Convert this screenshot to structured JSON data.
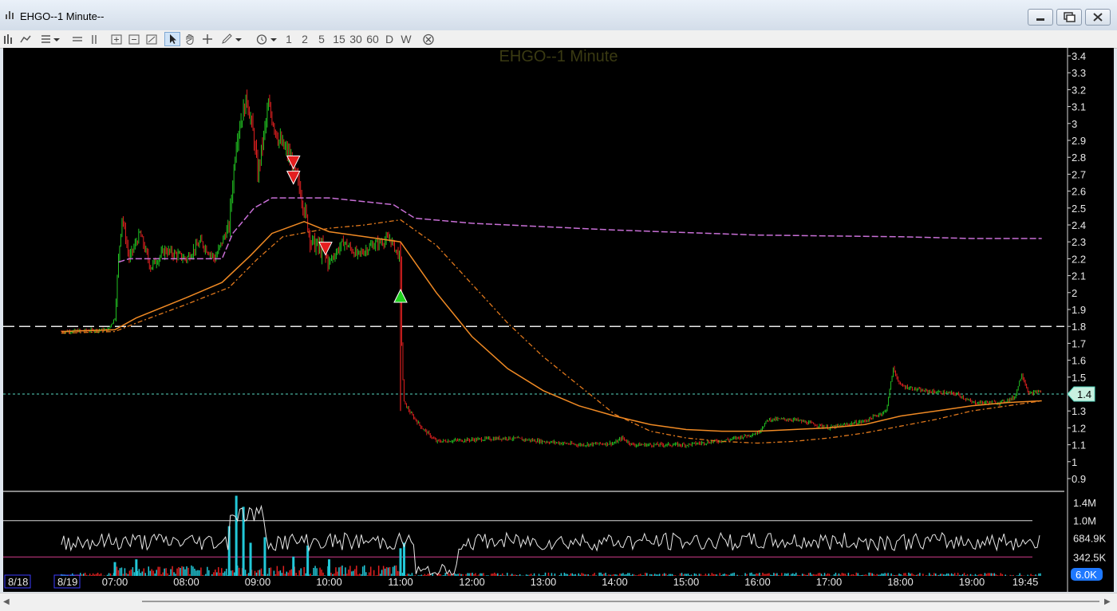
{
  "window": {
    "title": "EHGO--1 Minute--",
    "controls": [
      "minimize-icon",
      "maximize-icon",
      "close-icon"
    ]
  },
  "toolbar": {
    "tools": [
      "bar-chart-icon",
      "line-style-icon",
      "template-icon",
      "split-horizontal-icon",
      "split-vertical-icon",
      "zoom-in-icon",
      "zoom-out-icon",
      "zoom-fit-icon",
      "pointer-icon",
      "hand-icon",
      "crosshair-icon",
      "pencil-icon",
      "clock-icon"
    ],
    "intervals": [
      "1",
      "2",
      "5",
      "15",
      "30",
      "60",
      "D",
      "W"
    ],
    "close_all_icon": "circle-x-icon"
  },
  "chart": {
    "title": "EHGO--1 Minute",
    "price_axis_labels": [
      "3.4",
      "3.3",
      "3.2",
      "3.1",
      "3",
      "2.9",
      "2.8",
      "2.7",
      "2.6",
      "2.5",
      "2.4",
      "2.3",
      "2.2",
      "2.1",
      "2",
      "1.9",
      "1.8",
      "1.7",
      "1.6",
      "1.5",
      "1.4",
      "1.3",
      "1.2",
      "1.1",
      "1",
      "0.9"
    ],
    "last_price_badge": "1.4",
    "volume_axis_labels": [
      "1.4M",
      "1.0M",
      "684.9K",
      "342.5K"
    ],
    "volume_badge": "6.0K",
    "date_labels": [
      "8/18",
      "8/19"
    ],
    "time_labels": [
      "07:00",
      "08:00",
      "09:00",
      "10:00",
      "11:00",
      "12:00",
      "13:00",
      "14:00",
      "15:00",
      "16:00",
      "17:00",
      "18:00",
      "19:00",
      "19:45"
    ],
    "colors": {
      "background": "#000000",
      "up_candle": "#22c322",
      "down_candle": "#e02020",
      "vwap": "#c86fd6",
      "ema_fast": "#f08a24",
      "ema_slow_dashed": "#e0781c",
      "reference_line": "#e8e8e8",
      "last_price_line": "#58d8c0",
      "volume_bar_up": "#22c8d8",
      "volume_bar_down": "#e02020",
      "volume_line": "#e8e8e8",
      "volume_band_low": "#d23c8c",
      "sell_marker": "#e41e1e",
      "buy_marker": "#1ed21e",
      "title_text": "#3a3a12",
      "axis_text": "#e8e8e8",
      "volume_badge": "#1e78ff",
      "date_box": "#3c3cff"
    }
  },
  "chart_data": {
    "type": "candlestick",
    "title": "EHGO--1 Minute",
    "ylim": [
      0.9,
      3.45
    ],
    "reference_level": 1.8,
    "last_price": 1.4,
    "price_path": [
      [
        6.25,
        1.77
      ],
      [
        6.9,
        1.78
      ],
      [
        7.0,
        1.85
      ],
      [
        7.05,
        2.2
      ],
      [
        7.1,
        2.45
      ],
      [
        7.2,
        2.2
      ],
      [
        7.35,
        2.35
      ],
      [
        7.5,
        2.15
      ],
      [
        7.7,
        2.25
      ],
      [
        8.0,
        2.2
      ],
      [
        8.2,
        2.3
      ],
      [
        8.4,
        2.2
      ],
      [
        8.6,
        2.4
      ],
      [
        8.7,
        2.9
      ],
      [
        8.75,
        3.0
      ],
      [
        8.85,
        3.15
      ],
      [
        8.95,
        2.9
      ],
      [
        9.0,
        2.7
      ],
      [
        9.15,
        3.1
      ],
      [
        9.3,
        2.9
      ],
      [
        9.45,
        2.8
      ],
      [
        9.6,
        2.6
      ],
      [
        9.75,
        2.3
      ],
      [
        9.9,
        2.25
      ],
      [
        10.0,
        2.18
      ],
      [
        10.2,
        2.3
      ],
      [
        10.4,
        2.22
      ],
      [
        10.6,
        2.28
      ],
      [
        10.85,
        2.32
      ],
      [
        11.0,
        2.2
      ],
      [
        11.02,
        1.6
      ],
      [
        11.05,
        1.35
      ],
      [
        11.15,
        1.28
      ],
      [
        11.3,
        1.2
      ],
      [
        11.5,
        1.12
      ],
      [
        12.0,
        1.13
      ],
      [
        12.5,
        1.14
      ],
      [
        13.0,
        1.12
      ],
      [
        13.5,
        1.1
      ],
      [
        14.0,
        1.11
      ],
      [
        14.1,
        1.14
      ],
      [
        14.25,
        1.1
      ],
      [
        15.0,
        1.1
      ],
      [
        15.6,
        1.13
      ],
      [
        16.0,
        1.17
      ],
      [
        16.15,
        1.25
      ],
      [
        16.5,
        1.25
      ],
      [
        17.0,
        1.2
      ],
      [
        17.5,
        1.24
      ],
      [
        17.8,
        1.3
      ],
      [
        17.9,
        1.55
      ],
      [
        18.0,
        1.45
      ],
      [
        18.3,
        1.42
      ],
      [
        18.8,
        1.4
      ],
      [
        19.0,
        1.35
      ],
      [
        19.4,
        1.35
      ],
      [
        19.6,
        1.38
      ],
      [
        19.7,
        1.52
      ],
      [
        19.8,
        1.4
      ],
      [
        19.98,
        1.42
      ]
    ],
    "series": [
      {
        "name": "VWAP",
        "style": "dashed",
        "points": [
          [
            7.05,
            2.18
          ],
          [
            7.2,
            2.2
          ],
          [
            8.5,
            2.2
          ],
          [
            8.65,
            2.35
          ],
          [
            8.95,
            2.5
          ],
          [
            9.2,
            2.56
          ],
          [
            10.0,
            2.56
          ],
          [
            10.9,
            2.52
          ],
          [
            11.2,
            2.44
          ],
          [
            12.0,
            2.41
          ],
          [
            14.0,
            2.37
          ],
          [
            16.0,
            2.34
          ],
          [
            18.0,
            2.33
          ],
          [
            19.0,
            2.32
          ],
          [
            19.98,
            2.32
          ]
        ]
      },
      {
        "name": "EMA fast",
        "style": "solid",
        "points": [
          [
            6.25,
            1.77
          ],
          [
            7.0,
            1.78
          ],
          [
            7.3,
            1.85
          ],
          [
            8.0,
            1.97
          ],
          [
            8.5,
            2.06
          ],
          [
            8.9,
            2.22
          ],
          [
            9.2,
            2.35
          ],
          [
            9.65,
            2.42
          ],
          [
            10.0,
            2.36
          ],
          [
            10.5,
            2.33
          ],
          [
            11.0,
            2.3
          ],
          [
            11.5,
            2.0
          ],
          [
            12.0,
            1.74
          ],
          [
            12.5,
            1.55
          ],
          [
            13.0,
            1.42
          ],
          [
            13.5,
            1.33
          ],
          [
            14.0,
            1.27
          ],
          [
            14.5,
            1.22
          ],
          [
            15.0,
            1.19
          ],
          [
            15.5,
            1.18
          ],
          [
            16.0,
            1.18
          ],
          [
            16.5,
            1.19
          ],
          [
            17.0,
            1.2
          ],
          [
            17.5,
            1.22
          ],
          [
            18.0,
            1.27
          ],
          [
            18.5,
            1.3
          ],
          [
            19.0,
            1.33
          ],
          [
            19.5,
            1.35
          ],
          [
            19.98,
            1.36
          ]
        ]
      },
      {
        "name": "EMA slow",
        "style": "dash-dot",
        "points": [
          [
            6.25,
            1.76
          ],
          [
            7.0,
            1.77
          ],
          [
            7.3,
            1.82
          ],
          [
            8.0,
            1.93
          ],
          [
            8.6,
            2.03
          ],
          [
            9.0,
            2.2
          ],
          [
            9.35,
            2.33
          ],
          [
            10.0,
            2.38
          ],
          [
            10.5,
            2.4
          ],
          [
            11.0,
            2.43
          ],
          [
            11.5,
            2.28
          ],
          [
            12.0,
            2.05
          ],
          [
            12.5,
            1.82
          ],
          [
            13.0,
            1.62
          ],
          [
            13.5,
            1.45
          ],
          [
            14.0,
            1.28
          ],
          [
            14.5,
            1.18
          ],
          [
            15.0,
            1.14
          ],
          [
            15.5,
            1.12
          ],
          [
            16.0,
            1.11
          ],
          [
            16.5,
            1.12
          ],
          [
            17.0,
            1.14
          ],
          [
            17.5,
            1.17
          ],
          [
            18.0,
            1.21
          ],
          [
            18.5,
            1.25
          ],
          [
            19.0,
            1.3
          ],
          [
            19.5,
            1.33
          ],
          [
            19.98,
            1.36
          ]
        ]
      }
    ],
    "markers": [
      {
        "type": "sell",
        "x": 9.5,
        "y": 2.77
      },
      {
        "type": "sell",
        "x": 9.5,
        "y": 2.68
      },
      {
        "type": "sell",
        "x": 9.95,
        "y": 2.26
      },
      {
        "type": "buy",
        "x": 11.0,
        "y": 1.98
      }
    ],
    "volume": {
      "ylim": [
        0,
        1.4
      ],
      "bands": [
        1.0,
        0.3425
      ],
      "spikes": [
        [
          7.0,
          0.25
        ],
        [
          7.3,
          0.3
        ],
        [
          8.6,
          0.9
        ],
        [
          8.7,
          1.45
        ],
        [
          8.8,
          1.25
        ],
        [
          8.9,
          0.6
        ],
        [
          9.1,
          0.7
        ],
        [
          9.5,
          0.35
        ],
        [
          9.7,
          0.55
        ],
        [
          10.0,
          0.3
        ],
        [
          11.0,
          0.5
        ],
        [
          11.05,
          0.6
        ]
      ]
    }
  }
}
